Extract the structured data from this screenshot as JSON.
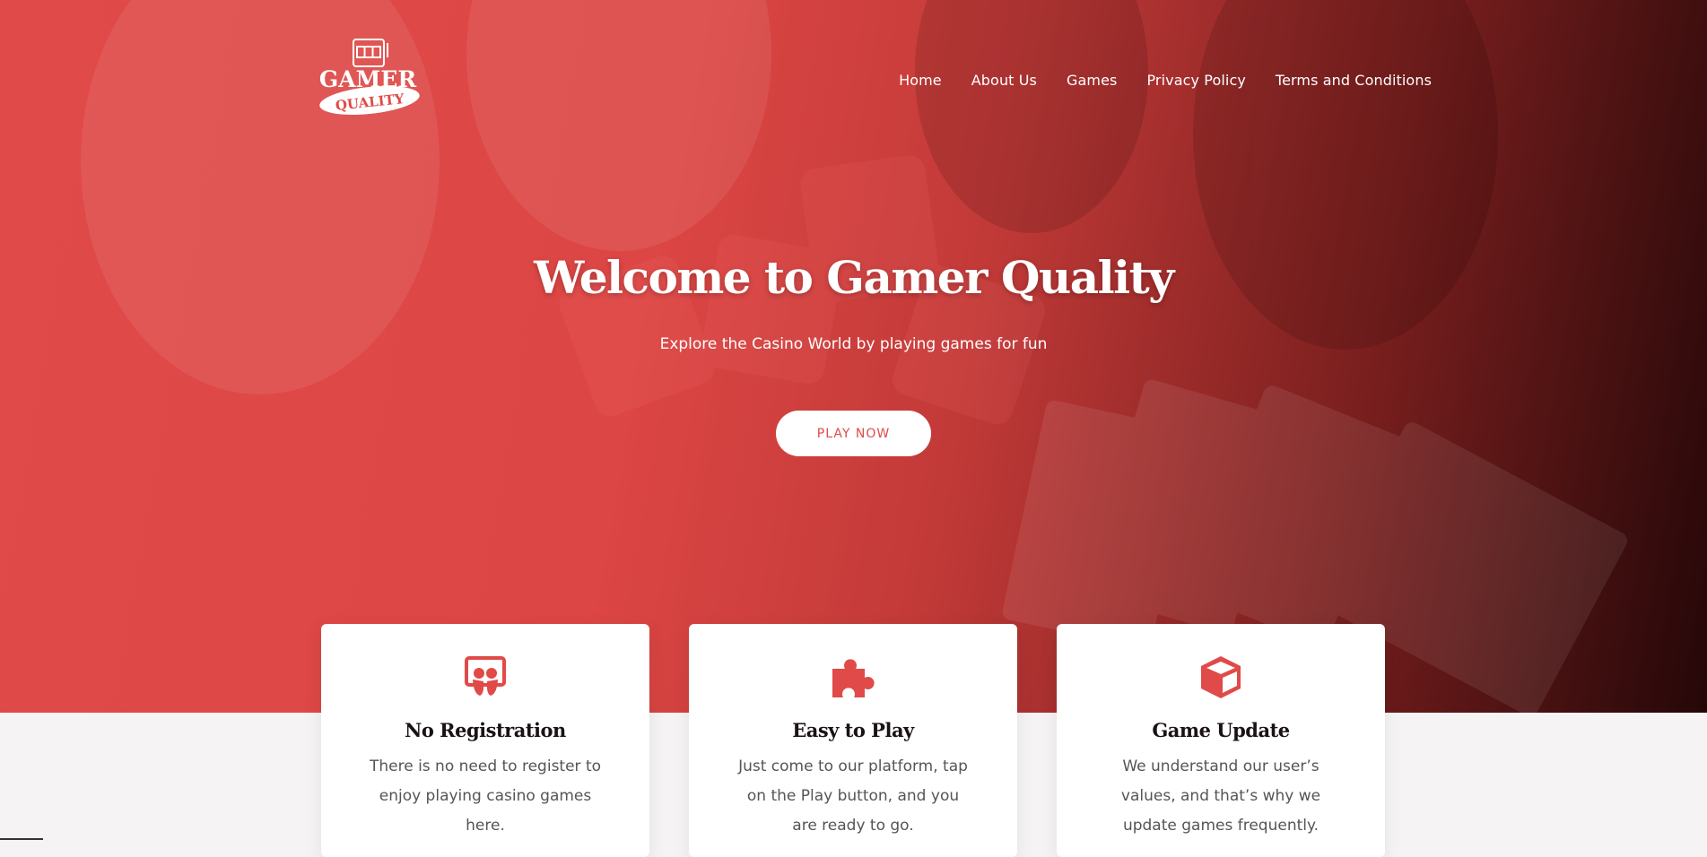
{
  "brand": {
    "logo_top": "GAMER",
    "logo_bottom": "QUALITY",
    "logo_icon": "slot-machine-icon"
  },
  "nav": {
    "items": [
      {
        "label": "Home"
      },
      {
        "label": "About Us"
      },
      {
        "label": "Games"
      },
      {
        "label": "Privacy Policy"
      },
      {
        "label": "Terms and Conditions"
      }
    ]
  },
  "hero": {
    "title": "Welcome to Gamer Quality",
    "subtitle": "Explore the Casino World by playing games for fun",
    "cta_label": "PLAY NOW"
  },
  "features": [
    {
      "icon": "slideshare-icon",
      "title": "No Registration",
      "text": "There is no need to register to enjoy playing casino games here."
    },
    {
      "icon": "puzzle-piece-icon",
      "title": "Easy to Play",
      "text": "Just come to our platform, tap on the Play button, and you are ready to go."
    },
    {
      "icon": "cube-icon",
      "title": "Game Update",
      "text": "We understand our user’s values, and that’s why we update games frequently."
    }
  ],
  "colors": {
    "accent": "#e04a48",
    "hero_dark": "#250708",
    "card_bg": "#ffffff",
    "page_bg": "#f5f3f4"
  }
}
